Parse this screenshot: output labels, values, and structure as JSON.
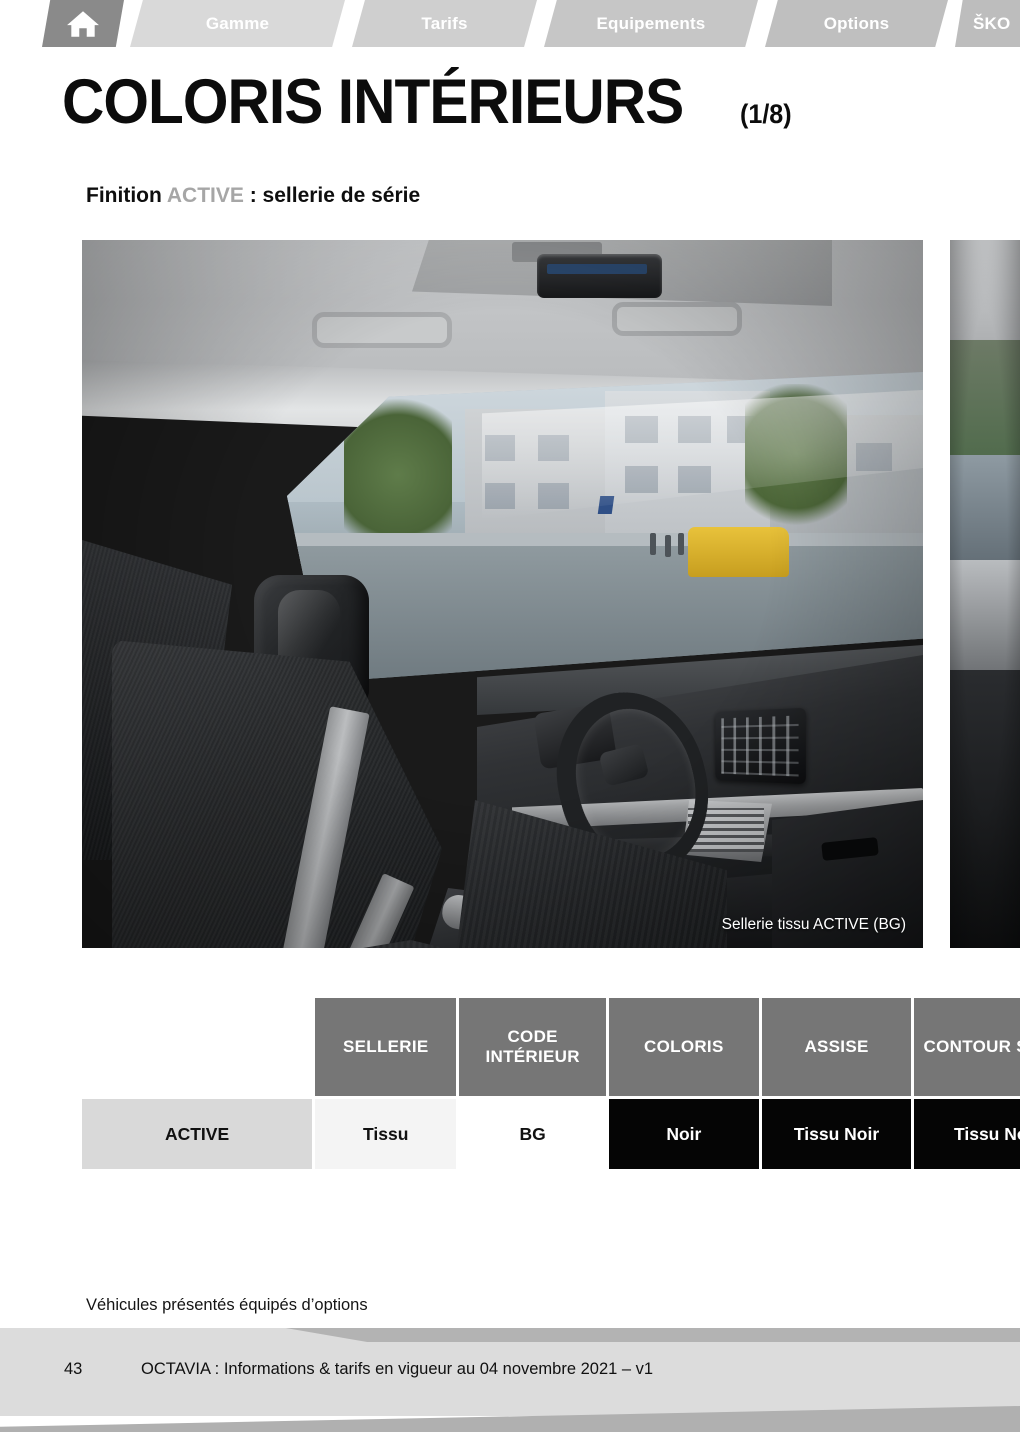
{
  "nav": {
    "home_icon": "home-icon",
    "tabs": [
      {
        "label": "Gamme"
      },
      {
        "label": "Tarifs"
      },
      {
        "label": "Equipements"
      },
      {
        "label": "Options"
      },
      {
        "label": "ŠKO"
      }
    ]
  },
  "header": {
    "title": "COLORIS INTÉRIEURS",
    "counter": "(1/8)"
  },
  "subtitle": {
    "prefix": "Finition ",
    "trim": "ACTIVE",
    "suffix": " : sellerie de série"
  },
  "photo": {
    "caption": "Sellerie tissu ACTIVE (BG)"
  },
  "table": {
    "headers": [
      "",
      "SELLERIE",
      "CODE INTÉRIEUR",
      "COLORIS",
      "ASSISE",
      "CONTOUR SIÈGE"
    ],
    "rows": [
      {
        "finition": "ACTIVE",
        "sellerie": "Tissu",
        "code_interieur": "BG",
        "coloris": "Noir",
        "assise": "Tissu Noir",
        "contour_siege": "Tissu Noir"
      }
    ]
  },
  "note": "Véhicules présentés équipés d’options",
  "footer": {
    "page": "43",
    "text": "OCTAVIA : Informations & tarifs en vigueur au 04 novembre 2021 – v1"
  },
  "colors": {
    "nav_home": "#8a8a8a",
    "nav_tab": "#cccccc",
    "header_cell": "#767676",
    "finition_cell": "#d9d9d9",
    "black_cell": "#050505",
    "footer_band": "#dcdcdc"
  }
}
